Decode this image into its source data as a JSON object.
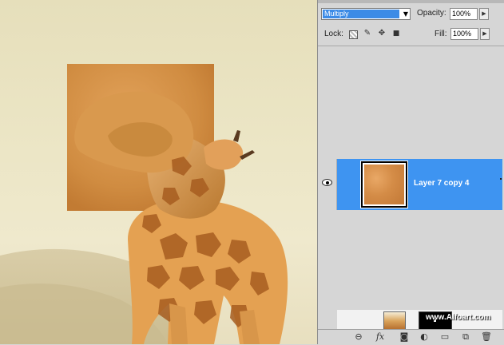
{
  "layers_panel": {
    "blend_mode": "Multiply",
    "opacity_label": "Opacity:",
    "opacity_value": "100%",
    "lock_label": "Lock:",
    "fill_label": "Fill:",
    "fill_value": "100%",
    "layers": [
      {
        "name": "Layer 7 copy 4",
        "visible": true,
        "selected": true
      }
    ],
    "bottom_toolbar_icons": [
      "link-icon",
      "fx-icon",
      "mask-icon",
      "adjustment-icon",
      "group-folder-icon",
      "new-layer-icon",
      "trash-icon"
    ]
  },
  "canvas": {
    "subject": "giraffe",
    "colors": {
      "sky": "#e9e2c1",
      "sand": "#d8caa0",
      "orange_square": "#d4903f"
    }
  },
  "watermark": "www.Alfoart.com"
}
